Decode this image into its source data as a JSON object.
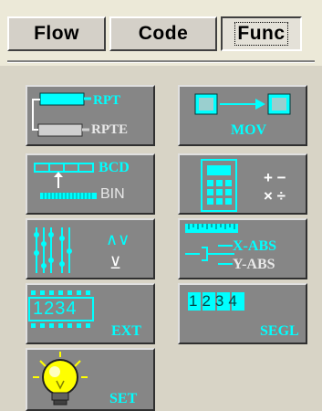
{
  "tabs": [
    {
      "label": "Flow"
    },
    {
      "label": "Code"
    },
    {
      "label": "Func",
      "active": true
    }
  ],
  "buttons": {
    "rpt": {
      "label1": "RPT",
      "label2": "RPTE"
    },
    "mov": {
      "label": "MOV"
    },
    "bcd": {
      "label1": "BCD",
      "label2": "BIN"
    },
    "math": {
      "plus_minus": "+ −",
      "times_div": "× ÷"
    },
    "logic": {
      "symbols": "∧∨",
      "xor": "⊻"
    },
    "abs": {
      "label1": "X-ABS",
      "label2": "Y-ABS"
    },
    "ext": {
      "digits": "1234",
      "label": "EXT"
    },
    "segl": {
      "digits": "1234",
      "label": "SEGL"
    },
    "set": {
      "label": "SET"
    }
  },
  "colors": {
    "accent": "#00FFFF",
    "button_face": "#868686",
    "panel": "#D8D4C6",
    "window": "#ECE9D8"
  }
}
